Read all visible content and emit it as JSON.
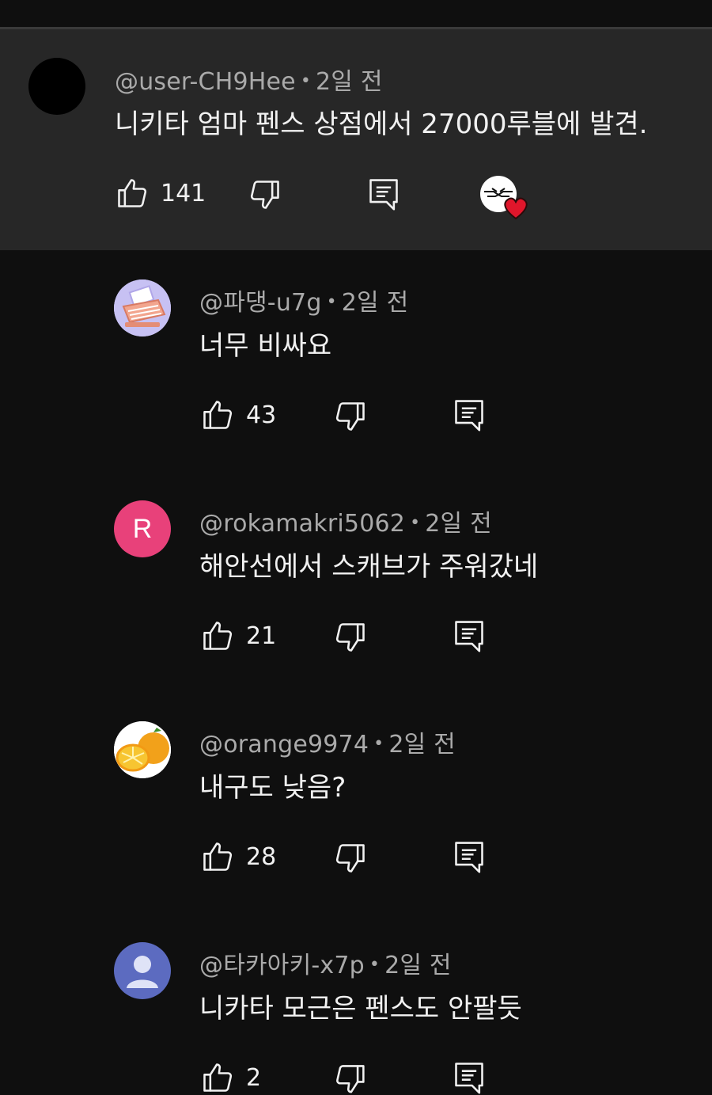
{
  "comments": [
    {
      "handle": "@user-CH9Hee",
      "time": "2일 전",
      "text": "니키타 엄마 펜스 상점에서 27000루블에 발견.",
      "likes": "141",
      "avatar_color": "#000000",
      "highlighted": true
    },
    {
      "handle": "@파댕-u7g",
      "time": "2일 전",
      "text": "너무 비싸요",
      "likes": "43",
      "avatar": "typewriter-avatar"
    },
    {
      "handle": "@rokamakri5062",
      "time": "2일 전",
      "text": "해안선에서 스캐브가 주워갔네",
      "likes": "21",
      "avatar_letter": "R",
      "avatar_color": "#e8417a"
    },
    {
      "handle": "@orange9974",
      "time": "2일 전",
      "text": "내구도 낮음?",
      "likes": "28",
      "avatar": "orange-avatar"
    },
    {
      "handle": "@타카아키-x7p",
      "time": "2일 전",
      "text": "니카타 모근은 펜스도 안팔듯",
      "likes": "2",
      "avatar": "default-person-avatar",
      "avatar_color": "#5c6bc0"
    }
  ],
  "dot": "•",
  "colors": {
    "background": "#0f0f0f",
    "highlight_background": "#272727",
    "meta_text": "#aaaaaa",
    "heart": "#e0162b"
  }
}
